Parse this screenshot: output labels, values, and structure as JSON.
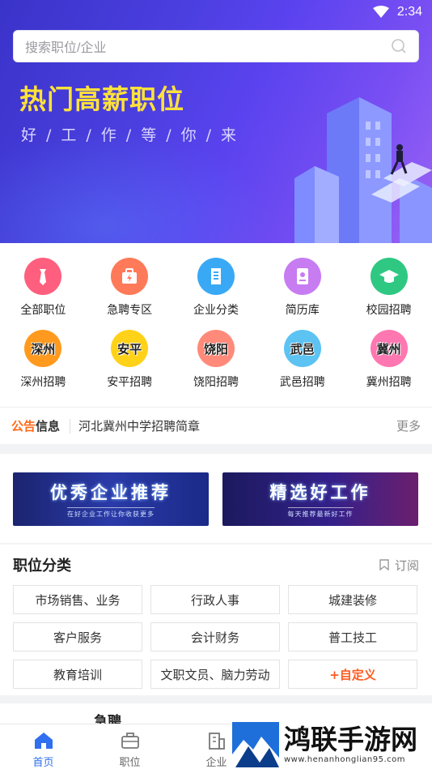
{
  "status_bar": {
    "time": "2:34"
  },
  "search": {
    "placeholder": "搜索职位/企业"
  },
  "hero": {
    "title": "热门高薪职位",
    "subtitle": "好/工/作/等/你/来"
  },
  "quick_entries": [
    {
      "label": "全部职位",
      "icon": "tie-icon",
      "color": "#ff5f7e"
    },
    {
      "label": "急聘专区",
      "icon": "urgent-bag-icon",
      "color": "#ff7a59"
    },
    {
      "label": "企业分类",
      "icon": "building-icon",
      "color": "#3aa9f5"
    },
    {
      "label": "简历库",
      "icon": "resume-icon",
      "color": "#c77cf2"
    },
    {
      "label": "校园招聘",
      "icon": "graduation-cap-icon",
      "color": "#2fc882"
    },
    {
      "label": "深州招聘",
      "city": "深州",
      "color": "#ff9a1f"
    },
    {
      "label": "安平招聘",
      "city": "安平",
      "color": "#ffd21a"
    },
    {
      "label": "饶阳招聘",
      "city": "饶阳",
      "color": "#ff8a7a"
    },
    {
      "label": "武邑招聘",
      "city": "武邑",
      "color": "#5cc3f2"
    },
    {
      "label": "冀州招聘",
      "city": "冀州",
      "color": "#ff77b0"
    }
  ],
  "notice": {
    "badge_a": "公告",
    "badge_b": "信息",
    "text": "河北冀州中学招聘简章",
    "more": "更多"
  },
  "promos": [
    {
      "title": "优秀企业推荐",
      "subtitle": "在好企业工作让你收获更多"
    },
    {
      "title": "精选好工作",
      "subtitle": "每天推荐最新好工作"
    }
  ],
  "category": {
    "title": "职位分类",
    "subscribe": "订阅",
    "tags": [
      "市场销售、业务",
      "行政人事",
      "城建装修",
      "客户服务",
      "会计财务",
      "普工技工",
      "教育培训",
      "文职文员、脑力劳动",
      "+自定义"
    ]
  },
  "peek": {
    "text": "急聘"
  },
  "nav": {
    "items": [
      {
        "label": "首页",
        "active": true
      },
      {
        "label": "职位"
      },
      {
        "label": "企业"
      }
    ]
  },
  "watermark": {
    "brand": "鸿联手游网",
    "url": "www.henanhonglian95.com"
  }
}
